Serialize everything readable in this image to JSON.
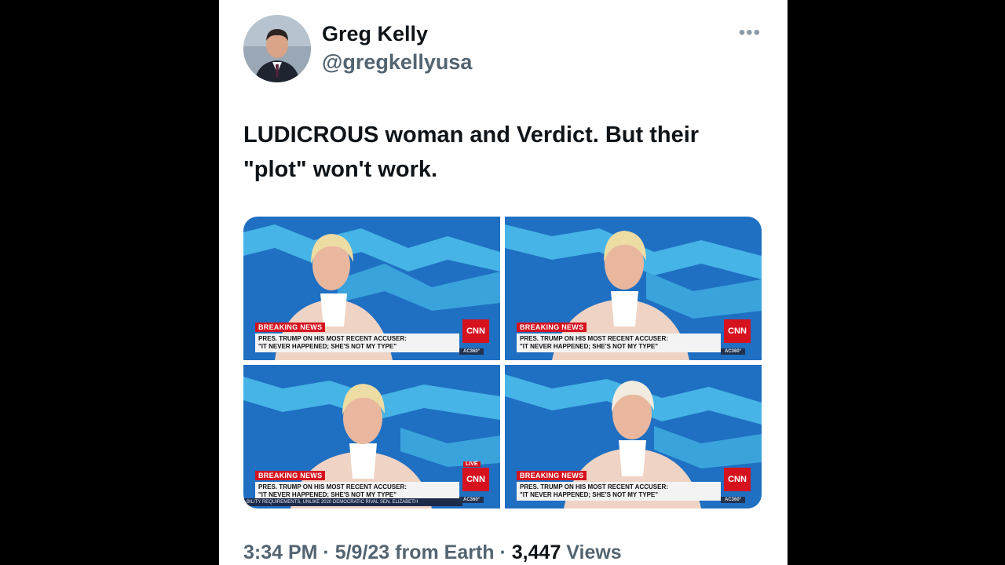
{
  "author": {
    "name": "Greg Kelly",
    "handle": "@gregkellyusa"
  },
  "more_menu": "•••",
  "tweet": {
    "line1": "LUDICROUS woman and Verdict.  But their",
    "line2": "\"plot\" won't work."
  },
  "media": [
    {
      "breaking": "BREAKING NEWS",
      "line1": "PRES. TRUMP ON HIS MOST RECENT ACCUSER:",
      "line2": "\"IT NEVER HAPPENED; SHE'S NOT MY TYPE\"",
      "network": "CNN",
      "show": "AC360°"
    },
    {
      "breaking": "BREAKING NEWS",
      "line1": "PRES. TRUMP ON HIS MOST RECENT ACCUSER:",
      "line2": "\"IT NEVER HAPPENED; SHE'S NOT MY TYPE\"",
      "network": "CNN",
      "show": "AC360°"
    },
    {
      "breaking": "BREAKING NEWS",
      "line1": "PRES. TRUMP ON HIS MOST RECENT ACCUSER:",
      "line2": "\"IT NEVER HAPPENED; SHE'S NOT MY TYPE\"",
      "network": "CNN",
      "show": "AC360°",
      "live": "LIVE",
      "ticker": "BILITY REQUIREMENTS, UNLIKE 2020 DEMOCRATIC RIVAL SEN. ELIZABETH"
    },
    {
      "breaking": "BREAKING NEWS",
      "line1": "PRES. TRUMP ON HIS MOST RECENT ACCUSER:",
      "line2": "\"IT NEVER HAPPENED; SHE'S NOT MY TYPE\"",
      "network": "CNN",
      "show": "AC360°"
    }
  ],
  "footer": {
    "meta": "3:34 PM · 5/9/23 from Earth · ",
    "views_count": "3,447",
    "views_label": " Views"
  },
  "colors": {
    "text": "#0f1419",
    "muted": "#536471",
    "cnn_red": "#d6121f",
    "studio_blue": "#1f6fc2"
  }
}
